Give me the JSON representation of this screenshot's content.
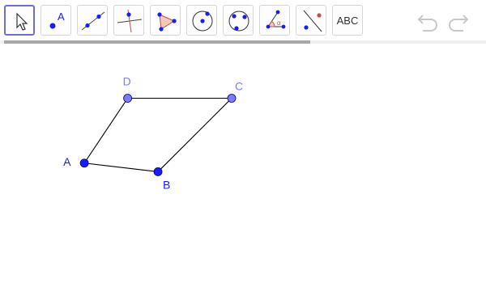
{
  "toolbar": {
    "tools": [
      {
        "name": "move",
        "selected": true
      },
      {
        "name": "point",
        "label": "A"
      },
      {
        "name": "line"
      },
      {
        "name": "perpendicular-line"
      },
      {
        "name": "polygon"
      },
      {
        "name": "circle-center-point"
      },
      {
        "name": "circle-three-points"
      },
      {
        "name": "angle",
        "label": "α"
      },
      {
        "name": "reflect-about-line"
      },
      {
        "name": "text",
        "label": "ABC"
      }
    ],
    "undo_icon": "undo-icon",
    "redo_icon": "redo-icon",
    "scroll_progress": 0.63
  },
  "colors": {
    "free_point": "#1a1aff",
    "dependent_point": "#7b7bff",
    "segment": "#000000",
    "selection": "#6e6ed2"
  },
  "geometry": {
    "points": [
      {
        "label": "A",
        "x": 0.6,
        "y": 1.5
      },
      {
        "label": "B",
        "x": 2.3,
        "y": 1.3
      },
      {
        "label": "C",
        "x": 4.0,
        "y": 3.0
      },
      {
        "label": "D",
        "x": 1.6,
        "y": 3.0
      }
    ],
    "segments": [
      [
        "A",
        "B"
      ],
      [
        "B",
        "C"
      ],
      [
        "C",
        "D"
      ],
      [
        "D",
        "A"
      ]
    ]
  }
}
